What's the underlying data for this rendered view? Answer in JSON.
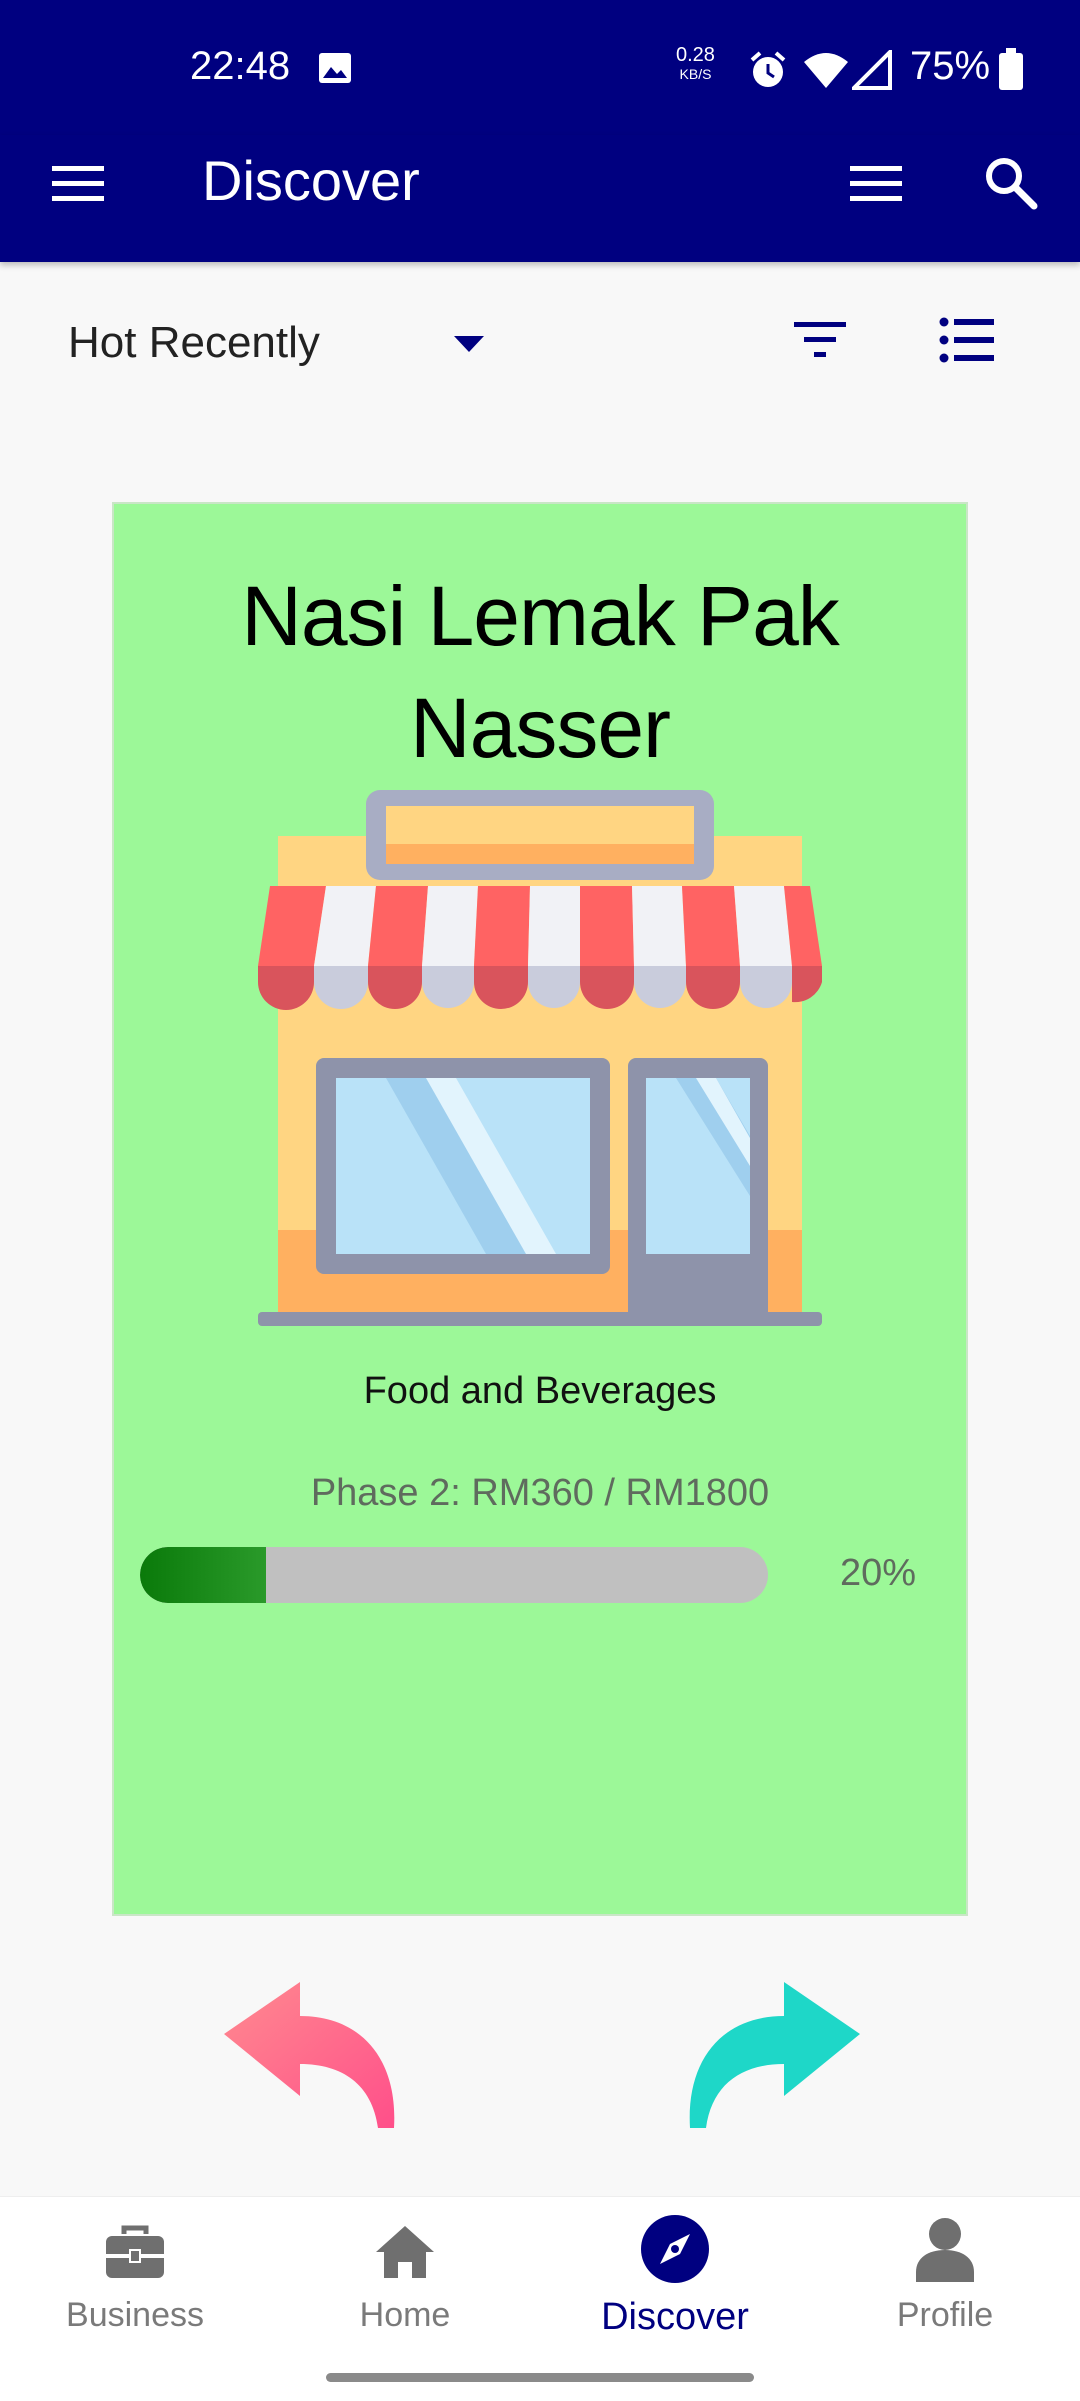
{
  "status_bar": {
    "time": "22:48",
    "net_speed_value": "0.28",
    "net_speed_unit": "KB/S",
    "battery": "75%"
  },
  "app_bar": {
    "title": "Discover",
    "icons": [
      "menu-icon",
      "list-menu-icon",
      "search-icon"
    ]
  },
  "filter_row": {
    "sort_selected": "Hot Recently",
    "icons": [
      "dropdown-arrow-icon",
      "filter-icon",
      "list-view-icon"
    ]
  },
  "card": {
    "name": "Nasi Lemak Pak Nasser",
    "category": "Food and Beverages",
    "phase_text": "Phase 2: RM360 / RM1800",
    "progress_fraction": 0.2,
    "percent_label": "20%",
    "background": "#9cf898"
  },
  "actions": {
    "icons": [
      "swipe-back-icon",
      "swipe-forward-icon"
    ],
    "back_color": "#ff6f8a",
    "forward_color": "#1ed7c8"
  },
  "bottom_nav": {
    "active": "Discover",
    "items": [
      {
        "label": "Business",
        "icon": "briefcase-icon"
      },
      {
        "label": "Home",
        "icon": "home-icon"
      },
      {
        "label": "Discover",
        "icon": "compass-icon"
      },
      {
        "label": "Profile",
        "icon": "person-icon"
      }
    ]
  },
  "colors": {
    "primary": "#000080",
    "progress_fill": "#0a7a0a",
    "progress_track": "#c0c0c0"
  }
}
